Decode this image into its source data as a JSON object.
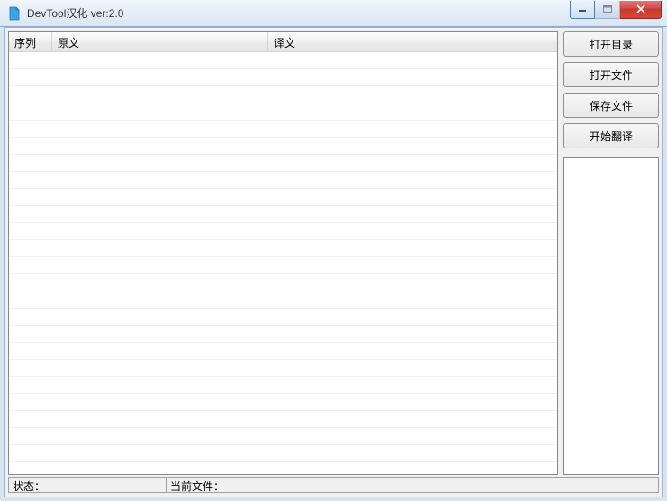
{
  "window": {
    "title": "DevTool汉化 ver:2.0"
  },
  "table": {
    "columns": {
      "seq": "序列",
      "original": "原文",
      "translated": "译文"
    },
    "rows": []
  },
  "buttons": {
    "open_dir": "打开目录",
    "open_file": "打开文件",
    "save_file": "保存文件",
    "start_translate": "开始翻译"
  },
  "status": {
    "state_label": "状态：",
    "state_value": "",
    "file_label": "当前文件：",
    "file_value": ""
  }
}
